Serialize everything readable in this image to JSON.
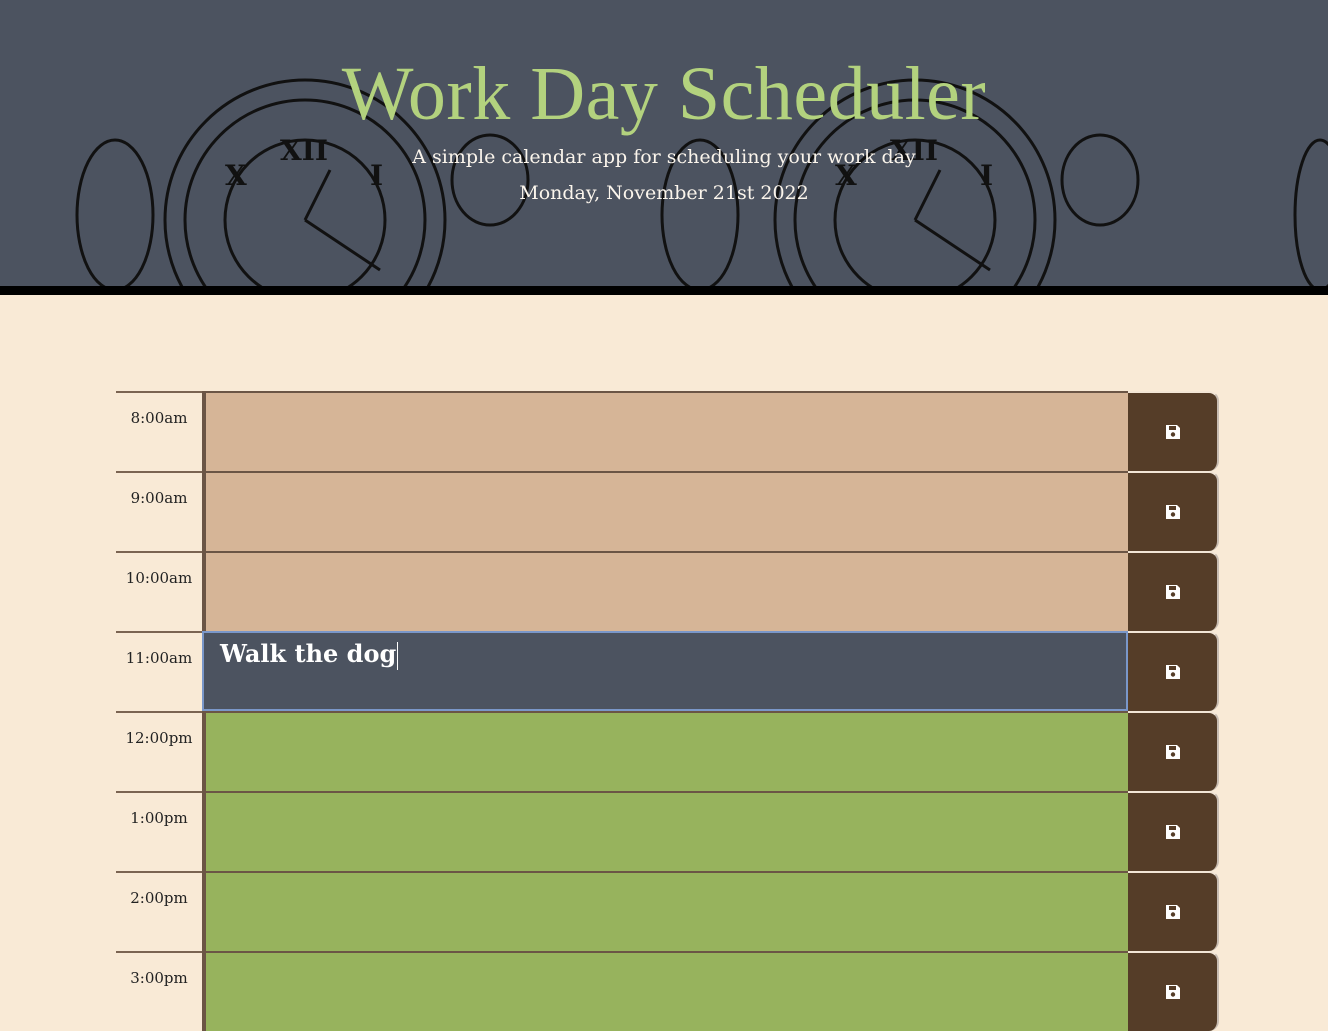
{
  "header": {
    "title": "Work Day Scheduler",
    "subtitle": "A simple calendar app for scheduling your work day",
    "current_date": "Monday, November 21st 2022"
  },
  "colors": {
    "past": "#d6b597",
    "present": "#4c5360",
    "future": "#97b35d",
    "save_button": "#553d28",
    "title": "#b3d27e"
  },
  "rows": [
    {
      "hour": "8:00am",
      "text": "",
      "state": "past"
    },
    {
      "hour": "9:00am",
      "text": "",
      "state": "past"
    },
    {
      "hour": "10:00am",
      "text": "",
      "state": "past"
    },
    {
      "hour": "11:00am",
      "text": "Walk the dog",
      "state": "present"
    },
    {
      "hour": "12:00pm",
      "text": "",
      "state": "future"
    },
    {
      "hour": "1:00pm",
      "text": "",
      "state": "future"
    },
    {
      "hour": "2:00pm",
      "text": "",
      "state": "future"
    },
    {
      "hour": "3:00pm",
      "text": "",
      "state": "future"
    }
  ],
  "save_icon": "floppy-disk-icon"
}
